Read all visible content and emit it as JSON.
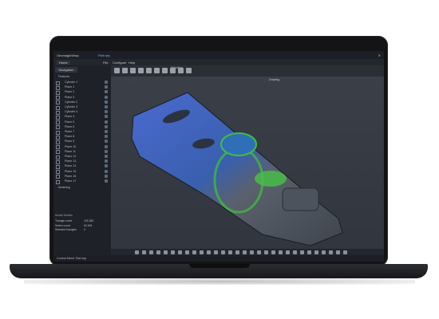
{
  "app": {
    "title_left": "GeomagicWrap",
    "title_doc": "Part.wrp",
    "menu": [
      "File",
      "Configure",
      "Help"
    ],
    "toolbar_label": "Selection"
  },
  "panel": {
    "tab": "Navigation",
    "root": "Features",
    "items": [
      "Cylinder 1",
      "Plane 1",
      "Plane 2",
      "Plane 3",
      "Cylinder 2",
      "Cylinder 3",
      "Cylinder 4",
      "Plane 4",
      "Plane 5",
      "Plane 6",
      "Plane 7",
      "Plane 8",
      "Plane 9",
      "Plane 10",
      "Plane 11",
      "Plane 12",
      "Plane 13",
      "Plane 14",
      "Plane 15",
      "Plane 16",
      "Plane 17"
    ],
    "extra": "Modeling"
  },
  "details": {
    "title": "Model Details",
    "rows": [
      {
        "label": "Triangle count",
        "value": "125,382"
      },
      {
        "label": "Vertex count",
        "value": "62,694"
      },
      {
        "label": "Selected triangles",
        "value": "0"
      }
    ]
  },
  "viewport": {
    "float_title": "Drawing"
  },
  "status": {
    "left": "Current Mesh: Part.wrp"
  },
  "colors": {
    "part": "#3b55a8",
    "highlight": "#3fbf3f",
    "background": "#31353d"
  }
}
